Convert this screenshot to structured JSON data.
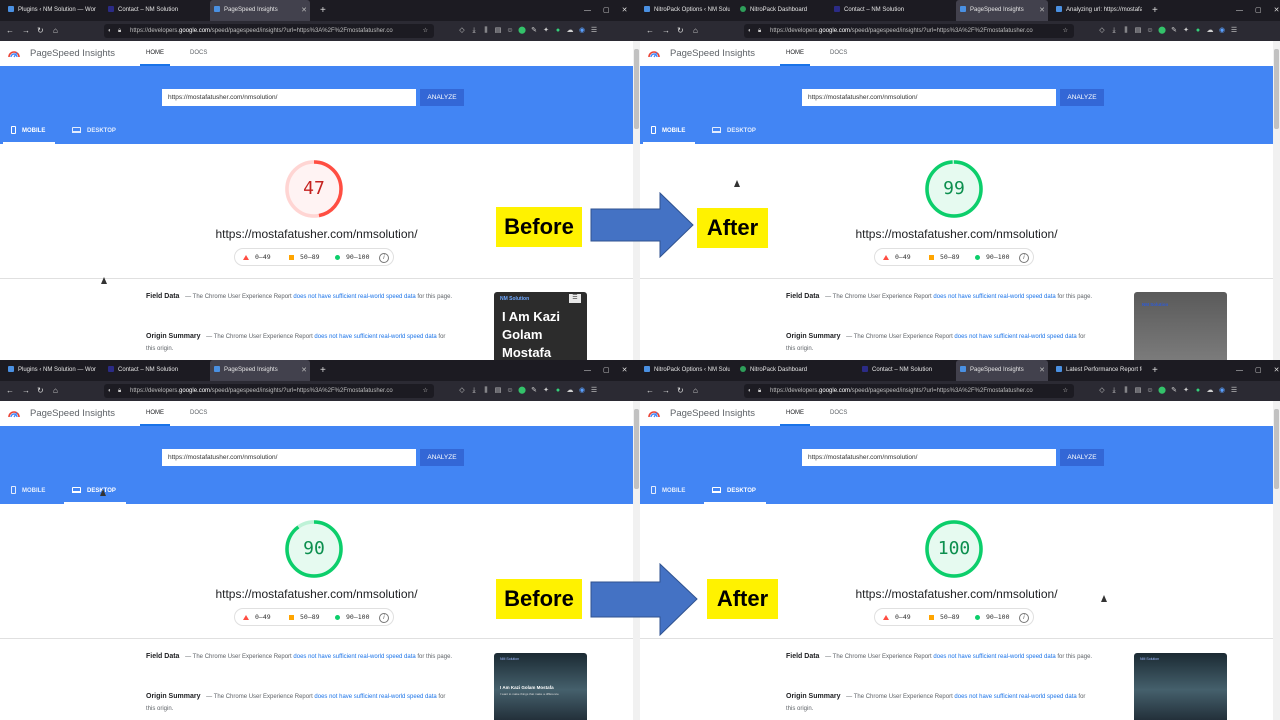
{
  "quadrants": [
    {
      "tabs": [
        "Plugins ‹ NM Solution — Word",
        "Contact – NM Solution",
        "PageSpeed Insights"
      ],
      "address": {
        "pre": "https://developers.",
        "host": "google.com",
        "post": "/speed/pagespeed/insights/?url=https%3A%2F%2Fmostafatusher.co"
      },
      "url_value": "https://mostafatusher.com/nmsolution/",
      "score": 47,
      "device": "mobile",
      "color": "#ff4e42",
      "bg": "#fff3f3",
      "thumb_brand": "NM Solution",
      "thumb_menu": "☰",
      "thumb_big": "I Am Kazi Golam Mostafa"
    },
    {
      "tabs": [
        "NitroPack Options ‹ NM Solutio",
        "NitroPack Dashboard",
        "Contact – NM Solution",
        "PageSpeed Insights",
        "Analyzing url: https://mostafat"
      ],
      "address": {
        "pre": "https://developers.",
        "host": "google.com",
        "post": "/speed/pagespeed/insights/?url=https%3A%2F%2Fmostafatusher.co"
      },
      "url_value": "https://mostafatusher.com/nmsolution/",
      "score": 99,
      "device": "mobile",
      "color": "#0cce6b",
      "bg": "#e6faf0",
      "thumb_brand": "NM Solution"
    },
    {
      "tabs": [
        "Plugins ‹ NM Solution — Word",
        "Contact – NM Solution",
        "PageSpeed Insights"
      ],
      "address": {
        "pre": "https://developers.",
        "host": "google.com",
        "post": "/speed/pagespeed/insights/?url=https%3A%2F%2Fmostafatusher.co"
      },
      "url_value": "https://mostafatusher.com/nmsolution/",
      "score": 90,
      "device": "desktop",
      "color": "#0cce6b",
      "bg": "#e6faf0",
      "thumb_brand": "NM Solution",
      "thumb_big": "I Am Kazi Golam Mostafa",
      "thumb_sub": "I want to make things that make a difference"
    },
    {
      "tabs": [
        "NitroPack Options ‹ NM Solutio",
        "NitroPack Dashboard",
        "Contact – NM Solution",
        "PageSpeed Insights",
        "Latest Performance Report for:"
      ],
      "address": {
        "pre": "https://developers.",
        "host": "google.com",
        "post": "/speed/pagespeed/insights/?url=https%3A%2F%2Fmostafatusher.co"
      },
      "url_value": "https://mostafatusher.com/nmsolution/",
      "score": 100,
      "device": "desktop",
      "color": "#0cce6b",
      "bg": "#e6faf0",
      "thumb_brand": "NM Solution"
    }
  ],
  "common": {
    "app_title": "PageSpeed Insights",
    "nav_home": "HOME",
    "nav_docs": "DOCS",
    "analyze": "ANALYZE",
    "mobile": "MOBILE",
    "desktop": "DESKTOP",
    "score_url": "https://mostafatusher.com/nmsolution/",
    "legend": [
      "0–49",
      "50–89",
      "90–100"
    ],
    "field_label": "Field Data",
    "origin_label": "Origin Summary",
    "crux_text": "— The Chrome User Experience Report",
    "crux_link": "does not have sufficient real-world speed data",
    "field_tail": "for this page.",
    "origin_tail": "for this origin."
  },
  "overlays": {
    "before": "Before",
    "after": "After"
  },
  "colors": {
    "google_blue": "#4285f4",
    "analyze_button": "#3367d6",
    "fail": "#ff4e42",
    "average": "#ffa400",
    "pass": "#0cce6b",
    "highlight": "#fff200",
    "arrow": "#4472c4"
  },
  "icons": [
    "reload-icon",
    "home-icon",
    "back-arrow-icon",
    "forward-arrow-icon",
    "lock-icon",
    "star-icon",
    "download-icon",
    "library-icon",
    "menu-icon",
    "phone-icon",
    "laptop-icon",
    "info-icon"
  ]
}
